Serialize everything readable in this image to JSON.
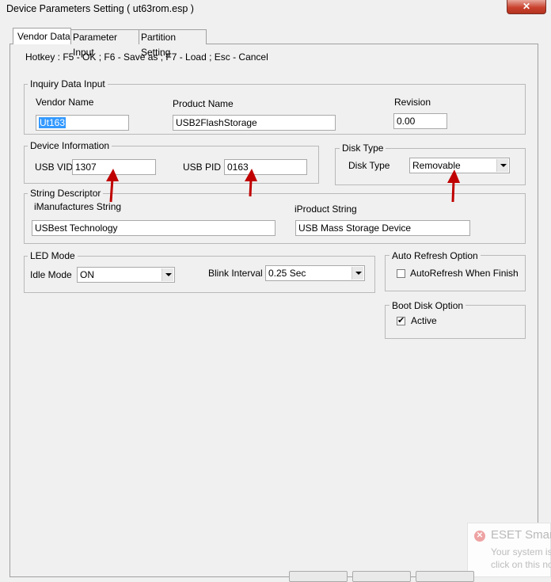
{
  "window": {
    "title": "Device Parameters Setting ( ut63rom.esp )",
    "close_glyph": "✕"
  },
  "tabs": [
    {
      "label": "Vendor Data"
    },
    {
      "label": "Parameter Input"
    },
    {
      "label": "Partition Setting"
    }
  ],
  "hotkey_text": "Hotkey : F5 - OK ; F6 - Save as ; F7 - Load ; Esc - Cancel",
  "inquiry": {
    "legend": "Inquiry Data Input",
    "vendor_name_label": "Vendor Name",
    "vendor_name_value": "Ut163",
    "product_name_label": "Product Name",
    "product_name_value": "USB2FlashStorage",
    "revision_label": "Revision",
    "revision_value": "0.00"
  },
  "device_info": {
    "legend": "Device Information",
    "usb_vid_label": "USB VID",
    "usb_vid_value": "1307",
    "usb_pid_label": "USB PID",
    "usb_pid_value": "0163"
  },
  "disk_type": {
    "legend": "Disk Type",
    "label": "Disk Type",
    "value": "Removable"
  },
  "string_descriptor": {
    "legend": "String Descriptor",
    "manufacturer_label": "iManufactures String",
    "manufacturer_value": "USBest Technology",
    "product_label": "iProduct String",
    "product_value": "USB Mass Storage Device"
  },
  "led_mode": {
    "legend": "LED Mode",
    "idle_label": "Idle Mode",
    "idle_value": "ON",
    "blink_label": "Blink Interval",
    "blink_value": "0.25 Sec"
  },
  "auto_refresh": {
    "legend": "Auto Refresh Option",
    "checkbox_label": "AutoRefresh When Finish",
    "checked": false
  },
  "boot_disk": {
    "legend": "Boot Disk Option",
    "checkbox_label": "Active",
    "checked": true,
    "check_glyph": "✔"
  },
  "eset_notification": {
    "title": "ESET Smar",
    "line1": "Your system is",
    "line2": "click on this no",
    "close_glyph": "✕"
  },
  "colors": {
    "annotation_arrow": "#c00000",
    "selection": "#3399ff"
  }
}
